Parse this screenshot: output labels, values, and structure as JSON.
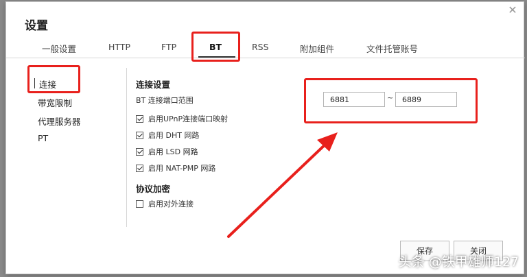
{
  "dialog": {
    "title": "设置"
  },
  "tabs": [
    {
      "label": "一般设置"
    },
    {
      "label": "HTTP"
    },
    {
      "label": "FTP"
    },
    {
      "label": "BT"
    },
    {
      "label": "RSS"
    },
    {
      "label": "附加组件"
    },
    {
      "label": "文件托管账号"
    }
  ],
  "active_tab": "BT",
  "sidebar": {
    "items": [
      {
        "label": "连接"
      },
      {
        "label": "带宽限制"
      },
      {
        "label": "代理服务器"
      },
      {
        "label": "PT"
      }
    ],
    "active": "连接"
  },
  "connection": {
    "section_title": "连接设置",
    "port_range_label": "BT 连接端口范围",
    "port_start": "6881",
    "port_separator": "~",
    "port_end": "6889",
    "options": [
      {
        "label": "启用UPnP连接端口映射",
        "checked": true
      },
      {
        "label": "启用 DHT 网路",
        "checked": true
      },
      {
        "label": "启用 LSD 网路",
        "checked": true
      },
      {
        "label": "启用 NAT-PMP 网路",
        "checked": true
      }
    ]
  },
  "encryption": {
    "section_title": "协议加密",
    "options": [
      {
        "label": "启用对外连接",
        "checked": false
      }
    ]
  },
  "buttons": {
    "save": "保存",
    "close": "关闭"
  },
  "watermark": "头条 @铁甲雄师127",
  "annotation_color": "#e8201c"
}
